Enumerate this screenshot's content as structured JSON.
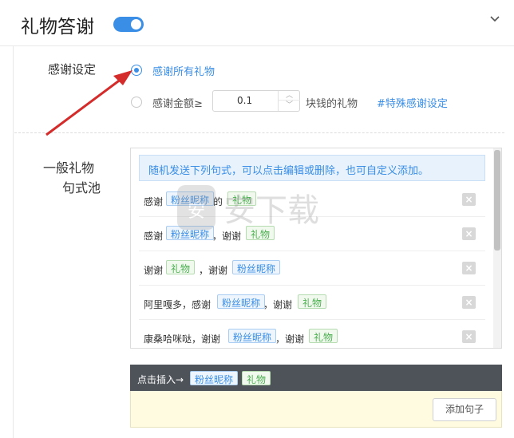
{
  "header": {
    "title": "礼物答谢",
    "toggle_on": true
  },
  "thanks_setting": {
    "label": "感谢设定",
    "option_all": "感谢所有礼物",
    "option_amount_prefix": "感谢金额≥",
    "amount_value": "0.1",
    "option_amount_suffix": "块钱的礼物",
    "special_link": "#特殊感谢设定",
    "selected": "option_all"
  },
  "pool": {
    "label_line1": "一般礼物",
    "label_line2": "句式池",
    "info": "随机发送下列句式，可以点击编辑或删除，也可自定义添加。",
    "rows": [
      {
        "s1": "感谢",
        "t1": "粉丝昵称",
        "s2": "的",
        "t2": "礼物"
      },
      {
        "s1": "感谢",
        "t1": "粉丝昵称",
        "s2": "，谢谢",
        "t2": "礼物"
      },
      {
        "s1": "谢谢",
        "t1": "礼物",
        "s2": "，谢谢",
        "t2": "粉丝昵称"
      },
      {
        "s1": "阿里嘎多，感谢",
        "t1": "粉丝昵称",
        "s2": "，谢谢",
        "t2": "礼物"
      },
      {
        "s1": "康桑哈咪哒，谢谢",
        "t1": "粉丝昵称",
        "s2": "，谢谢",
        "t2": "礼物"
      }
    ]
  },
  "insert": {
    "label": "点击插入→",
    "tag_fan": "粉丝昵称",
    "tag_gift": "礼物",
    "add_button": "添加句子"
  },
  "watermark": {
    "text": "安下载"
  },
  "colors": {
    "accent": "#3a8ee6",
    "gift_green": "#4caf50",
    "arrow_red": "#d42b2b",
    "bar_dark": "#4e5359",
    "compose_bg": "#fefbe1"
  }
}
